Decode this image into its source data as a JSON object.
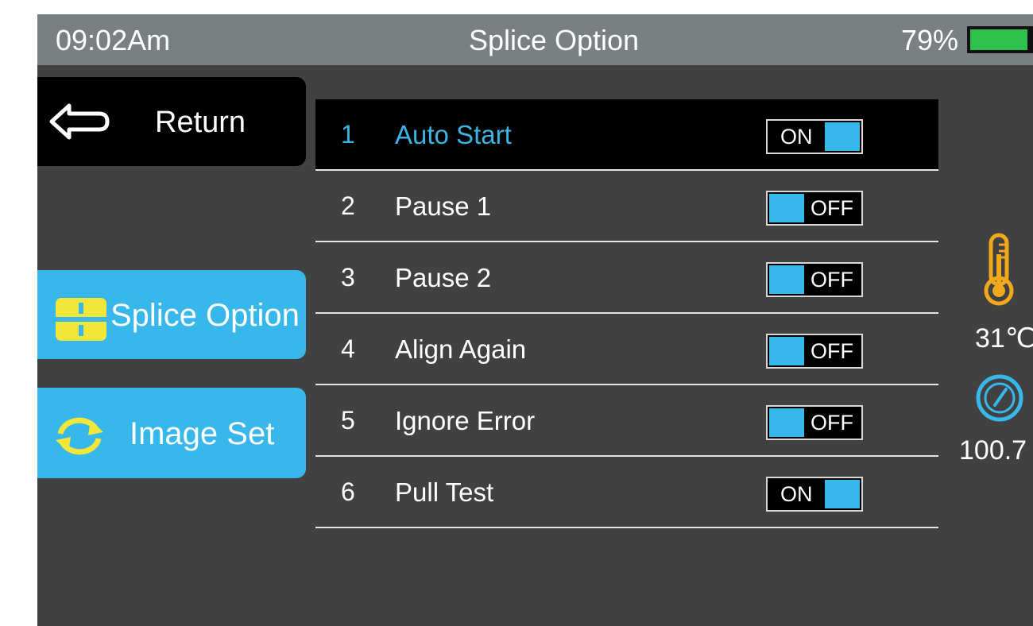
{
  "status_bar": {
    "time": "09:02Am",
    "title": "Splice Option",
    "battery_text": "79%",
    "battery_level": 0.79
  },
  "sidebar": {
    "return_label": "Return",
    "items": [
      {
        "label": "Splice Option",
        "icon": "splice-option-icon",
        "active": true
      },
      {
        "label": "Image Set",
        "icon": "refresh-icon",
        "active": true
      }
    ]
  },
  "options": [
    {
      "num": "1",
      "label": "Auto Start",
      "state": "ON",
      "selected": true
    },
    {
      "num": "2",
      "label": "Pause 1",
      "state": "OFF",
      "selected": false
    },
    {
      "num": "3",
      "label": "Pause 2",
      "state": "OFF",
      "selected": false
    },
    {
      "num": "4",
      "label": "Align Again",
      "state": "OFF",
      "selected": false
    },
    {
      "num": "5",
      "label": "Ignore Error",
      "state": "OFF",
      "selected": false
    },
    {
      "num": "6",
      "label": "Pull Test",
      "state": "ON",
      "selected": false
    }
  ],
  "sensors": {
    "temperature": "31℃",
    "pressure": "100.7"
  },
  "colors": {
    "background": "#414141",
    "status_bar": "#7a7f82",
    "accent_blue": "#38b7ea",
    "selected_text": "#3ab4e3",
    "icon_yellow": "#f1e73a",
    "battery_green": "#2fbf4c",
    "thermo_orange": "#f0a81c"
  }
}
